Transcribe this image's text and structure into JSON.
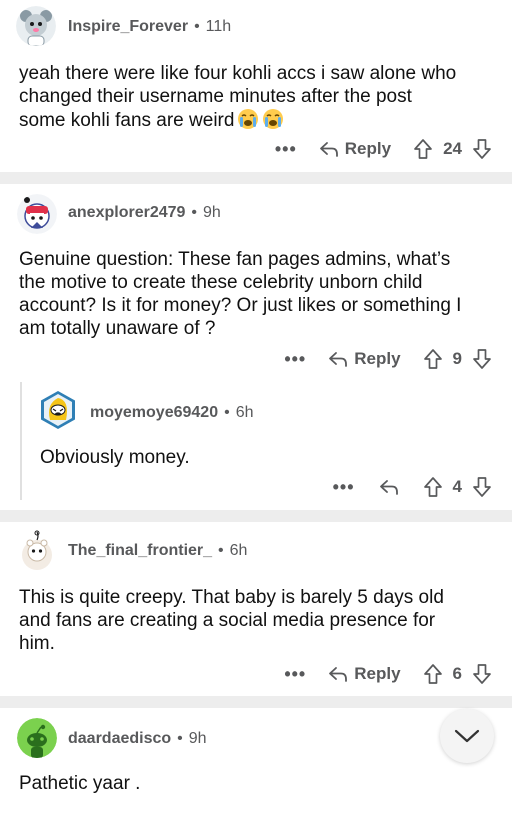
{
  "comments": [
    {
      "username": "Inspire_Forever",
      "time": "11h",
      "body_lines": [
        "yeah there were like four kohli accs i saw alone who",
        "changed their username minutes after the post",
        "some kohli fans are weird"
      ],
      "emoji": [
        "😭",
        "😭"
      ],
      "reply_label": "Reply",
      "votes": "24"
    },
    {
      "username": "anexplorer2479",
      "time": "9h",
      "body_lines": [
        "Genuine question: These fan pages admins, what’s",
        "the motive to create these celebrity unborn child",
        "account? Is it for money? Or just likes or something I",
        "am totally unaware of ?"
      ],
      "reply_label": "Reply",
      "votes": "9"
    },
    {
      "username": "moyemoye69420",
      "time": "6h",
      "body_lines": [
        "Obviously money."
      ],
      "votes": "4"
    },
    {
      "username": "The_final_frontier_",
      "time": "6h",
      "body_lines": [
        "This is quite creepy. That baby is barely 5 days old",
        "and fans are creating a social media presence for",
        "him."
      ],
      "reply_label": "Reply",
      "votes": "6"
    },
    {
      "username": "daardaedisco",
      "time": "9h",
      "body_lines": [
        "Pathetic yaar ."
      ]
    }
  ],
  "more_label": "•••",
  "separator_dot": "•",
  "colors": {
    "meta": "#58595b",
    "separator": "#ededed",
    "text": "#111111"
  },
  "icons": {
    "reply": "reply-arrow-icon",
    "upvote": "upvote-arrow-icon",
    "downvote": "downvote-arrow-icon",
    "fab": "chevron-down-icon"
  }
}
